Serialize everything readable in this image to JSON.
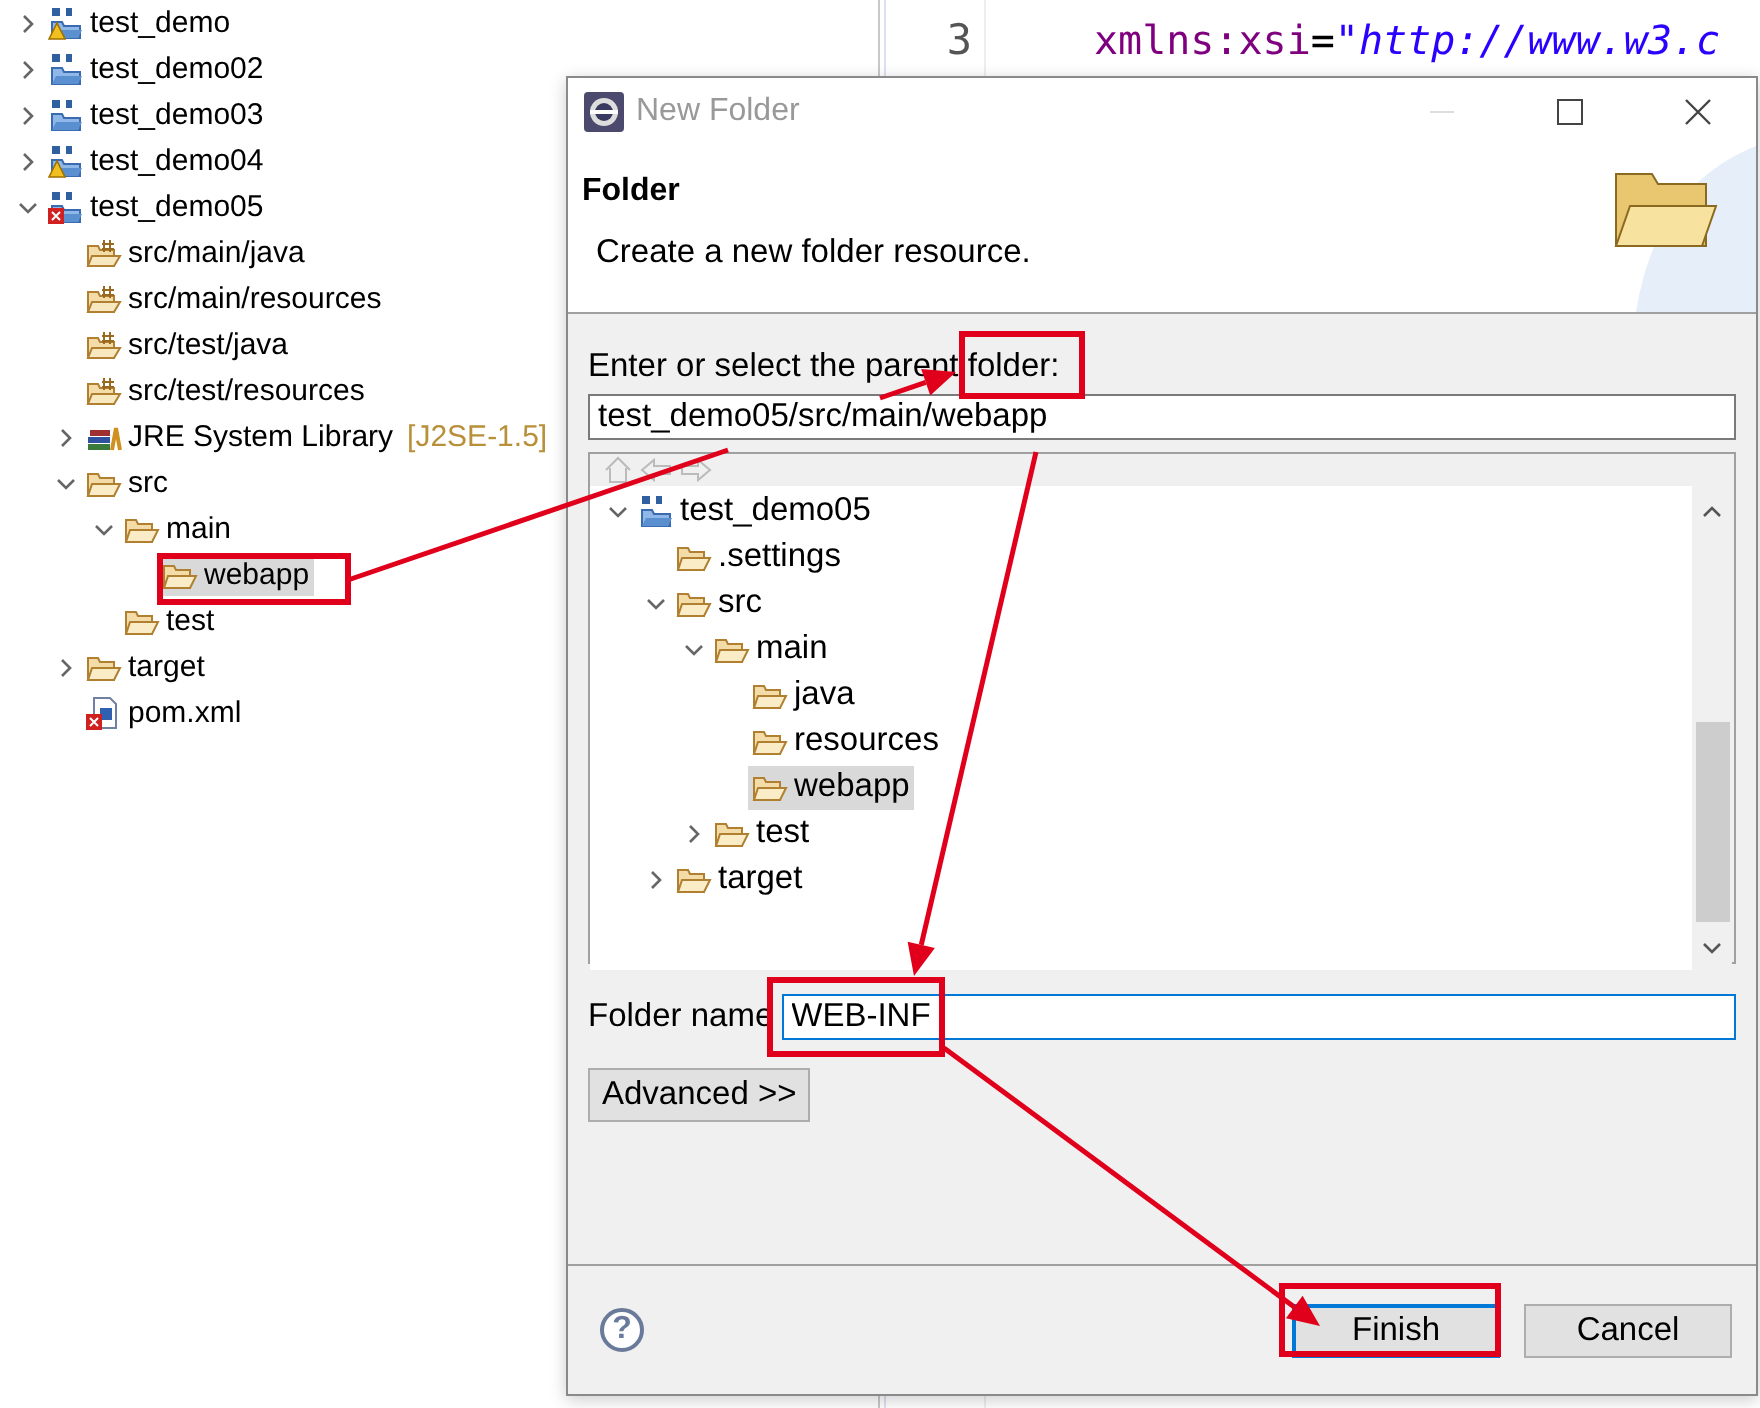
{
  "explorer": {
    "items": [
      {
        "label": "test_demo",
        "kind": "project-warning",
        "expanded": false,
        "selected": false
      },
      {
        "label": "test_demo02",
        "kind": "project",
        "expanded": false,
        "selected": false
      },
      {
        "label": "test_demo03",
        "kind": "project",
        "expanded": false,
        "selected": false
      },
      {
        "label": "test_demo04",
        "kind": "project-warning",
        "expanded": false,
        "selected": false
      },
      {
        "label": "test_demo05",
        "kind": "project-error",
        "expanded": true,
        "selected": false,
        "children": [
          {
            "label": "src/main/java",
            "kind": "source",
            "selected": false
          },
          {
            "label": "src/main/resources",
            "kind": "source",
            "selected": false
          },
          {
            "label": "src/test/java",
            "kind": "source",
            "selected": false
          },
          {
            "label": "src/test/resources",
            "kind": "source",
            "selected": false
          },
          {
            "label": "JRE System Library",
            "decoration": "[J2SE-1.5]",
            "kind": "library",
            "expanded": false,
            "selected": false
          },
          {
            "label": "src",
            "kind": "folder",
            "expanded": true,
            "selected": false,
            "children": [
              {
                "label": "main",
                "kind": "folder",
                "expanded": true,
                "selected": false,
                "children": [
                  {
                    "label": "webapp",
                    "kind": "folder",
                    "selected": true
                  }
                ]
              },
              {
                "label": "test",
                "kind": "folder",
                "selected": false
              }
            ]
          },
          {
            "label": "target",
            "kind": "folder",
            "expanded": false,
            "selected": false
          },
          {
            "label": "pom.xml",
            "kind": "pom-error",
            "selected": false
          }
        ]
      }
    ]
  },
  "editor": {
    "lines": [
      {
        "number": "3",
        "attribute": "xmlns:xsi",
        "operator": "=",
        "value": "\"http://www.w3.c"
      }
    ]
  },
  "dialog": {
    "title": "New Folder",
    "heading": "Folder",
    "description": "Create a new folder resource.",
    "parent_label": "Enter or select the parent folder:",
    "parent_value": "test_demo05/src/main/webapp",
    "tree": [
      {
        "label": "test_demo05",
        "kind": "project",
        "expanded": true,
        "selected": false,
        "children": [
          {
            "label": ".settings",
            "kind": "folder",
            "selected": false
          },
          {
            "label": "src",
            "kind": "folder",
            "expanded": true,
            "selected": false,
            "children": [
              {
                "label": "main",
                "kind": "folder",
                "expanded": true,
                "selected": false,
                "children": [
                  {
                    "label": "java",
                    "kind": "folder",
                    "selected": false
                  },
                  {
                    "label": "resources",
                    "kind": "folder",
                    "selected": false
                  },
                  {
                    "label": "webapp",
                    "kind": "folder",
                    "selected": true
                  }
                ]
              },
              {
                "label": "test",
                "kind": "folder",
                "expanded": false,
                "selected": false
              }
            ]
          },
          {
            "label": "target",
            "kind": "folder",
            "expanded": false,
            "selected": false
          }
        ]
      }
    ],
    "folder_name_label": "Folder name",
    "folder_name_value": "WEB-INF",
    "advanced_button": "Advanced >>",
    "help_button": "?",
    "buttons": [
      {
        "label": "Finish",
        "default": true
      },
      {
        "label": "Cancel",
        "default": false
      }
    ]
  }
}
